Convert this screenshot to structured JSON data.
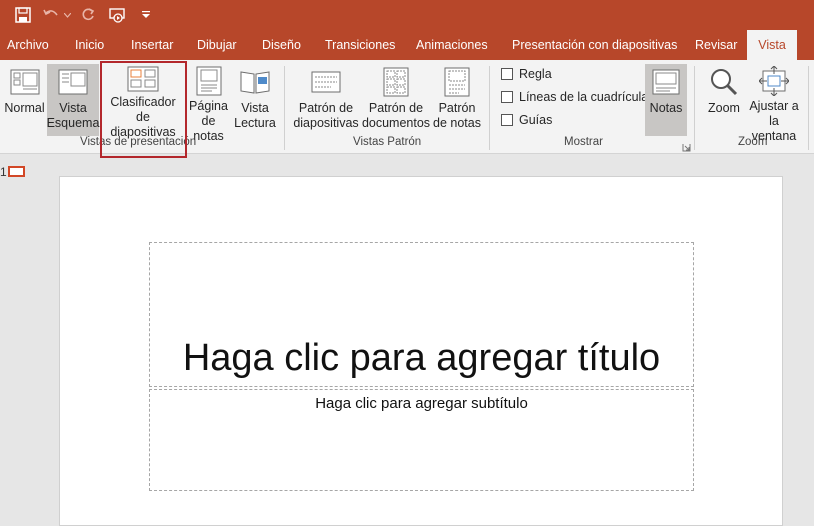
{
  "qat": {
    "icons": [
      "save-icon",
      "undo-icon",
      "undo-dropdown-icon",
      "redo-icon",
      "start-slideshow-icon",
      "customize-qat-icon"
    ]
  },
  "tabs": [
    "Archivo",
    "Inicio",
    "Insertar",
    "Dibujar",
    "Diseño",
    "Transiciones",
    "Animaciones",
    "Presentación con diapositivas",
    "Revisar",
    "Vista"
  ],
  "active_tab": "Vista",
  "ribbon": {
    "views": {
      "normal": "Normal",
      "outline": "Vista\nEsquema",
      "sorter": "Clasificador\nde diapositivas",
      "notes_page": "Página\nde notas",
      "reading": "Vista\nLectura",
      "group": "Vistas de presentación"
    },
    "masters": {
      "slide_master": "Patrón de\ndiapositivas",
      "handout_master": "Patrón de\ndocumentos",
      "notes_master": "Patrón\nde notas",
      "group": "Vistas Patrón"
    },
    "show": {
      "ruler": "Regla",
      "gridlines": "Líneas de la cuadrícula",
      "guides": "Guías",
      "notes": "Notas",
      "group": "Mostrar"
    },
    "zoom": {
      "zoom": "Zoom",
      "fit": "Ajustar a\nla ventana",
      "group": "Zoom"
    }
  },
  "thumbnail": {
    "number": "1"
  },
  "slide": {
    "title_placeholder": "Haga clic para agregar título",
    "subtitle_placeholder": "Haga clic para agregar subtítulo"
  },
  "colors": {
    "accent": "#b7472a",
    "highlight_box": "#b3272c",
    "ribbon_bg": "#f3f3f3"
  }
}
